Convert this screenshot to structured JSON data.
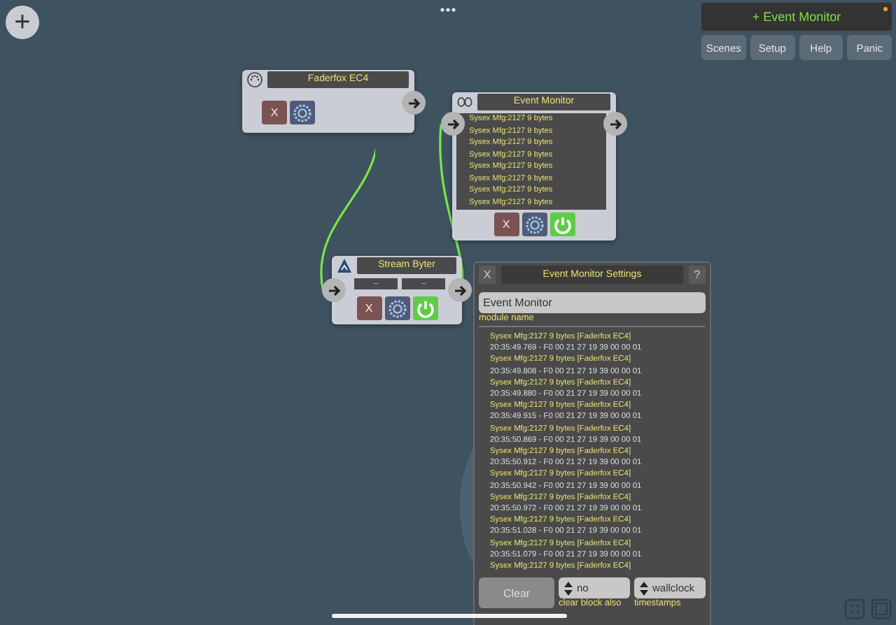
{
  "add_button": {
    "label": "+"
  },
  "top_bar": {
    "current_module": "+ Event Monitor",
    "unsaved": true,
    "buttons": [
      "Scenes",
      "Setup",
      "Help",
      "Panic"
    ]
  },
  "nodes": [
    {
      "kind": "source",
      "title": "Faderfox EC4",
      "remove": "X",
      "input": false,
      "output": true
    },
    {
      "kind": "monitor",
      "title": "Event Monitor",
      "remove": "X",
      "input": true,
      "output": true,
      "power_on": true,
      "lines": [
        "Sysex Mfg:2127 9 bytes",
        "Sysex Mfg:2127 9 bytes",
        "Sysex Mfg:2127 9 bytes",
        "Sysex Mfg:2127 9 bytes",
        "Sysex Mfg:2127 9 bytes",
        "Sysex Mfg:2127 9 bytes",
        "Sysex Mfg:2127 9 bytes",
        "Sysex Mfg:2127 9 bytes"
      ]
    },
    {
      "kind": "processor",
      "title": "Stream Byter",
      "remove": "X",
      "input": true,
      "output": true,
      "power_on": true,
      "fields": [
        "--",
        "--"
      ]
    }
  ],
  "settings": {
    "close": "X",
    "title": "Event Monitor Settings",
    "help": "?",
    "name_value": "Event Monitor",
    "name_label": "module name",
    "log": [
      {
        "event": "Sysex Mfg:2127 9 bytes [Faderfox EC4]",
        "detail": "20:35:49.769 - F0 00 21 27 19 39 00 00 01"
      },
      {
        "event": "Sysex Mfg:2127 9 bytes [Faderfox EC4]",
        "detail": "20:35:49.808 - F0 00 21 27 19 39 00 00 01"
      },
      {
        "event": "Sysex Mfg:2127 9 bytes [Faderfox EC4]",
        "detail": "20:35:49.880 - F0 00 21 27 19 39 00 00 01"
      },
      {
        "event": "Sysex Mfg:2127 9 bytes [Faderfox EC4]",
        "detail": "20:35:49.915 - F0 00 21 27 19 39 00 00 01"
      },
      {
        "event": "Sysex Mfg:2127 9 bytes [Faderfox EC4]",
        "detail": "20:35:50.869 - F0 00 21 27 19 39 00 00 01"
      },
      {
        "event": "Sysex Mfg:2127 9 bytes [Faderfox EC4]",
        "detail": "20:35:50.912 - F0 00 21 27 19 39 00 00 01"
      },
      {
        "event": "Sysex Mfg:2127 9 bytes [Faderfox EC4]",
        "detail": "20:35:50.942 - F0 00 21 27 19 39 00 00 01"
      },
      {
        "event": "Sysex Mfg:2127 9 bytes [Faderfox EC4]",
        "detail": "20:35:50.972 - F0 00 21 27 19 39 00 00 01"
      },
      {
        "event": "Sysex Mfg:2127 9 bytes [Faderfox EC4]",
        "detail": "20:35:51.028 - F0 00 21 27 19 39 00 00 01"
      },
      {
        "event": "Sysex Mfg:2127 9 bytes [Faderfox EC4]",
        "detail": "20:35:51.079 - F0 00 21 27 19 39 00 00 01"
      },
      {
        "event": "Sysex Mfg:2127 9 bytes [Faderfox EC4]"
      }
    ],
    "clear": "Clear",
    "clear_block": {
      "value": "no",
      "label": "clear block also"
    },
    "timestamps": {
      "value": "wallclock",
      "label": "timestamps"
    }
  }
}
